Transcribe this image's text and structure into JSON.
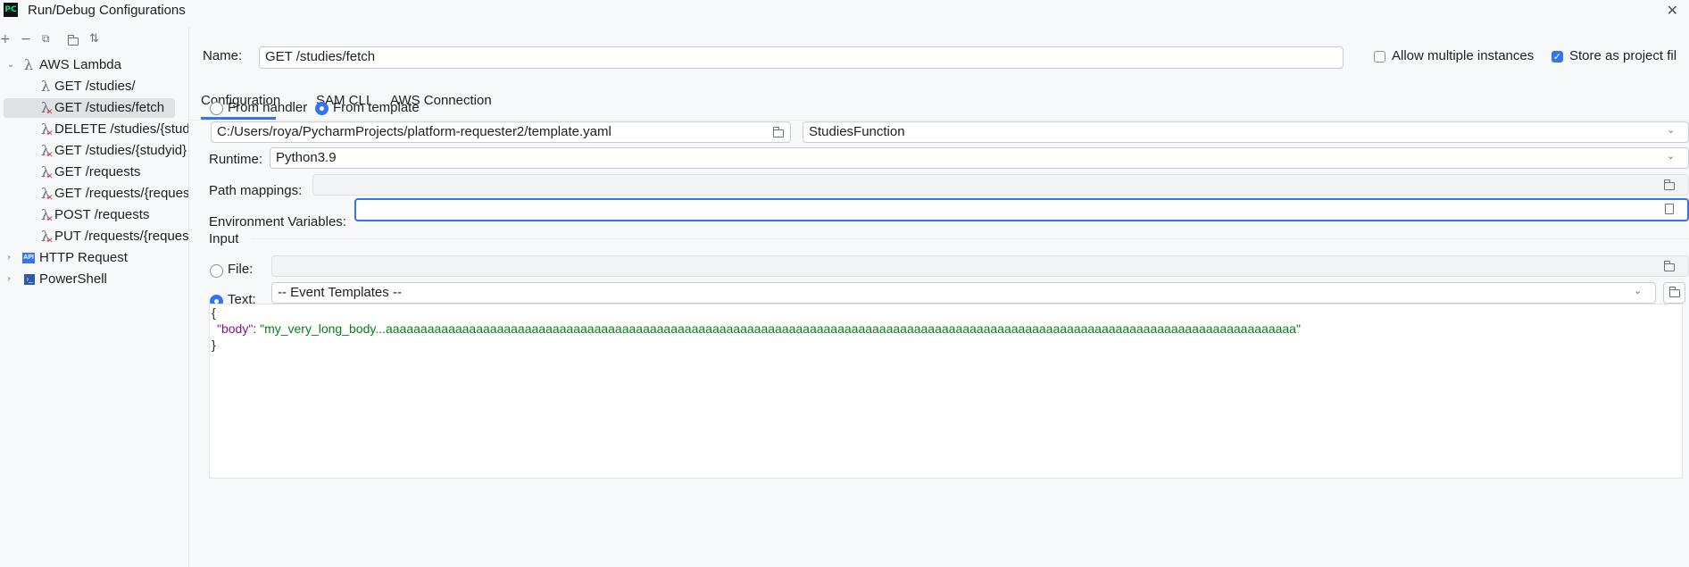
{
  "window": {
    "title": "Run/Debug Configurations",
    "app_logo": "PC"
  },
  "sidebar": {
    "toolbar": [
      "add-icon",
      "remove-icon",
      "copy-icon",
      "folder-icon",
      "sort-icon"
    ],
    "groups": [
      {
        "label": "AWS Lambda",
        "expanded": true,
        "icon": "lambda-icon"
      },
      {
        "label": "HTTP Request",
        "expanded": false,
        "icon": "api-icon"
      },
      {
        "label": "PowerShell",
        "expanded": false,
        "icon": "powershell-icon"
      }
    ],
    "items": [
      {
        "label": "GET /studies/",
        "error": false
      },
      {
        "label": "GET /studies/fetch",
        "error": true
      },
      {
        "label": "DELETE /studies/{stud",
        "error": true
      },
      {
        "label": "GET /studies/{studyid}",
        "error": true
      },
      {
        "label": "GET /requests",
        "error": true
      },
      {
        "label": "GET /requests/{reques",
        "error": true
      },
      {
        "label": "POST /requests",
        "error": true
      },
      {
        "label": "PUT /requests/{reques",
        "error": true
      }
    ]
  },
  "form": {
    "name_label": "Name:",
    "name_value": "GET /studies/fetch",
    "allow_multiple_label": "Allow multiple instances",
    "allow_multiple_checked": false,
    "store_label": "Store as project fil",
    "store_checked": true,
    "tabs": [
      "Configuration",
      "SAM CLI",
      "AWS Connection"
    ],
    "from_handler_label": "From handler",
    "from_template_label": "From template",
    "template_path": "C:/Users/roya/PycharmProjects/platform-requester2/template.yaml",
    "function_value": "StudiesFunction",
    "runtime_label": "Runtime:",
    "runtime_value": "Python3.9",
    "path_mappings_label": "Path mappings:",
    "env_vars_label": "Environment Variables:",
    "input_section": "Input",
    "file_label": "File:",
    "text_label": "Text:",
    "event_templates": "-- Event Templates --",
    "code": {
      "open_brace": "{",
      "key": "\"body\"",
      "colon": ": ",
      "value": "\"my_very_long_body...aaaaaaaaaaaaaaaaaaaaaaaaaaaaaaaaaaaaaaaaaaaaaaaaaaaaaaaaaaaaaaaaaaaaaaaaaaaaaaaaaaaaaaaaaaaaaaaaaaaaaaaaaaaaaaaaaaaaaaaaaaaaaaaaaaa\"",
      "close_brace": "}"
    }
  },
  "colors": {
    "accent": "#3574f0",
    "error": "#db3b4b",
    "json_key": "#871094",
    "json_string": "#067d17"
  }
}
